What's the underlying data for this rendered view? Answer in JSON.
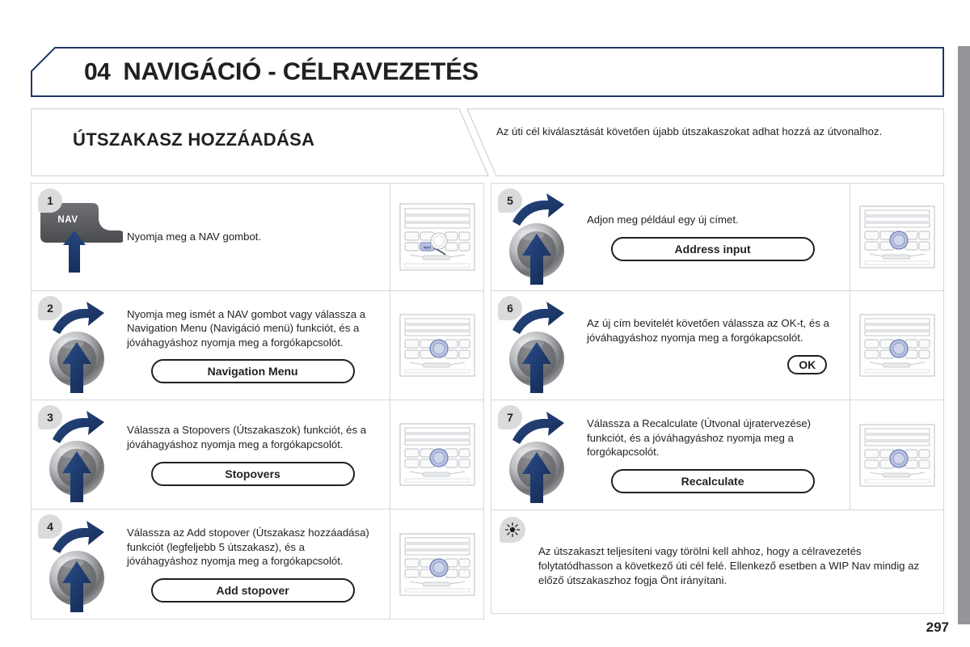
{
  "chapter": {
    "number": "04",
    "title": "NAVIGÁCIÓ - CÉLRAVEZETÉS"
  },
  "section": {
    "title": "ÚTSZAKASZ HOZZÁADÁSA",
    "intro": "Az úti cél kiválasztását követően újabb útszakaszokat adhat hozzá az útvonalhoz."
  },
  "steps_left": [
    {
      "number": "1",
      "icon": "nav-button-press-icon",
      "icon_label": "NAV",
      "text": "Nyomja meg a NAV gombot.",
      "pill": null,
      "thumb": "radio-panel-nav-highlighted"
    },
    {
      "number": "2",
      "icon": "rotary-knob-press-icon",
      "text": "Nyomja meg ismét a NAV gombot vagy válassza a Navigation Menu (Navigáció menü) funkciót, és a jóváhagyáshoz nyomja meg a forgókapcsolót.",
      "pill": "Navigation Menu",
      "thumb": "radio-panel-knob-highlighted"
    },
    {
      "number": "3",
      "icon": "rotary-knob-press-icon",
      "text": "Válassza a Stopovers (Útszakaszok) funkciót, és a jóváhagyáshoz nyomja meg a forgókapcsolót.",
      "pill": "Stopovers",
      "thumb": "radio-panel-knob-highlighted"
    },
    {
      "number": "4",
      "icon": "rotary-knob-press-icon",
      "text": "Válassza az Add stopover (Útszakasz hozzáadása) funkciót (legfeljebb 5 útszakasz), és a jóváhagyáshoz nyomja meg a forgókapcsolót.",
      "pill": "Add stopover",
      "thumb": "radio-panel-knob-highlighted"
    }
  ],
  "steps_right": [
    {
      "number": "5",
      "icon": "rotary-knob-press-icon",
      "text": "Adjon meg például egy új címet.",
      "pill": "Address input",
      "thumb": "radio-panel-knob-highlighted"
    },
    {
      "number": "6",
      "icon": "rotary-knob-press-icon",
      "text": "Az új cím bevitelét követően válassza az OK-t, és a jóváhagyáshoz nyomja meg a forgókapcsolót.",
      "pill": "OK",
      "pill_style": "ok",
      "thumb": "radio-panel-knob-highlighted"
    },
    {
      "number": "7",
      "icon": "rotary-knob-press-icon",
      "text": "Válassza a Recalculate (Útvonal újratervezése) funkciót, és a jóváhagyáshoz nyomja meg a forgókapcsolót.",
      "pill": "Recalculate",
      "thumb": "radio-panel-knob-highlighted"
    }
  ],
  "note": {
    "icon": "tip-bulb-icon",
    "text": "Az útszakaszt teljesíteni vagy törölni kell ahhoz, hogy a célravezetés folytatódhasson a következő úti cél felé. Ellenkező esetben a WIP Nav mindig az előző útszakaszhoz fogja Önt irányítani."
  },
  "page_number": "297",
  "colors": {
    "header_border": "#1f3864",
    "arrow_navy": "#1b3a6b",
    "badge_gray": "#d9dbdd",
    "edge_bar": "#939598",
    "knob_highlight": "#b9c3e0"
  }
}
